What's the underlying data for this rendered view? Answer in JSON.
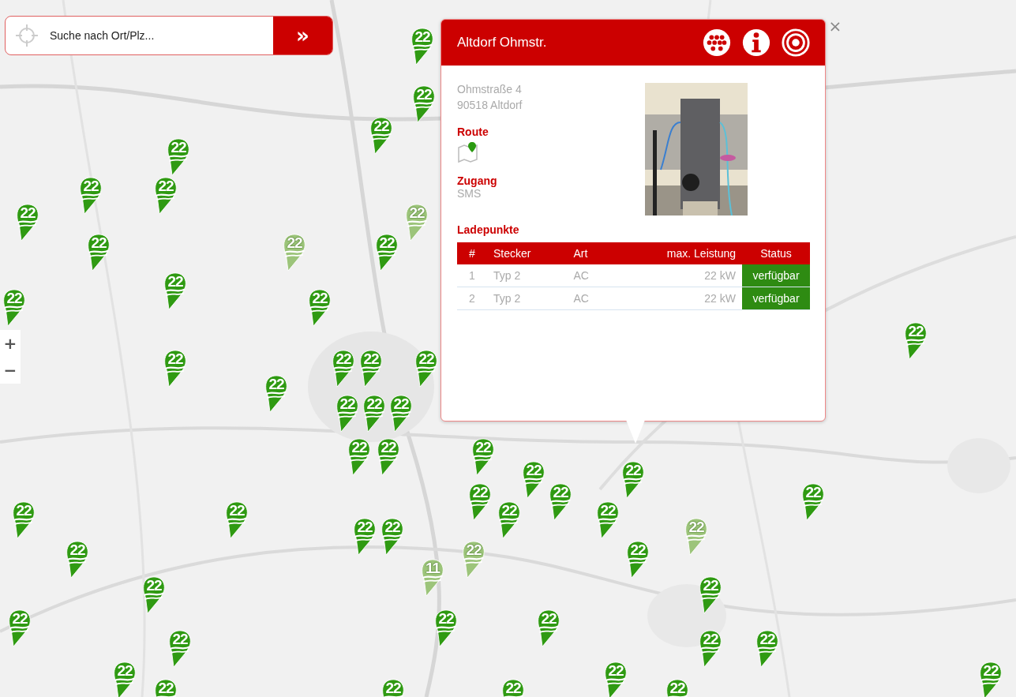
{
  "search": {
    "placeholder": "Suche nach Ort/Plz...",
    "button": "»"
  },
  "zoom_controls": [
    "+",
    "−"
  ],
  "markers": [
    {
      "label": "22",
      "faded": false
    },
    {
      "label": "22",
      "faded": false
    },
    {
      "label": "22",
      "faded": false
    },
    {
      "label": "22",
      "faded": false
    },
    {
      "label": "22",
      "faded": false
    },
    {
      "label": "22",
      "faded": false
    },
    {
      "label": "22",
      "faded": false
    },
    {
      "label": "22",
      "faded": true
    },
    {
      "label": "22",
      "faded": false
    },
    {
      "label": "22",
      "faded": true
    },
    {
      "label": "22",
      "faded": false
    },
    {
      "label": "22",
      "faded": false
    },
    {
      "label": "22",
      "faded": false
    },
    {
      "label": "22",
      "faded": false
    },
    {
      "label": "22",
      "faded": false
    },
    {
      "label": "22",
      "faded": false
    },
    {
      "label": "22",
      "faded": false
    },
    {
      "label": "22",
      "faded": false
    },
    {
      "label": "22",
      "faded": false
    },
    {
      "label": "22",
      "faded": false
    },
    {
      "label": "22",
      "faded": false
    },
    {
      "label": "22",
      "faded": false
    },
    {
      "label": "22",
      "faded": false
    },
    {
      "label": "22",
      "faded": false
    },
    {
      "label": "22",
      "faded": false
    },
    {
      "label": "22",
      "faded": false
    },
    {
      "label": "22",
      "faded": false
    },
    {
      "label": "22",
      "faded": false
    },
    {
      "label": "22",
      "faded": false
    },
    {
      "label": "22",
      "faded": false
    },
    {
      "label": "22",
      "faded": false
    },
    {
      "label": "22",
      "faded": false
    },
    {
      "label": "22",
      "faded": false
    },
    {
      "label": "22",
      "faded": false
    },
    {
      "label": "22",
      "faded": false
    },
    {
      "label": "22",
      "faded": false
    },
    {
      "label": "22",
      "faded": false
    },
    {
      "label": "22",
      "faded": true
    },
    {
      "label": "22",
      "faded": false
    },
    {
      "label": "22",
      "faded": true
    },
    {
      "label": "22",
      "faded": false
    },
    {
      "label": "11",
      "faded": true
    },
    {
      "label": "22",
      "faded": false
    },
    {
      "label": "22",
      "faded": false
    },
    {
      "label": "22",
      "faded": false
    },
    {
      "label": "22",
      "faded": false
    },
    {
      "label": "22",
      "faded": false
    },
    {
      "label": "22",
      "faded": false
    },
    {
      "label": "22",
      "faded": false
    },
    {
      "label": "22",
      "faded": false
    },
    {
      "label": "22",
      "faded": false
    },
    {
      "label": "22",
      "faded": false
    },
    {
      "label": "22",
      "faded": false
    },
    {
      "label": "22",
      "faded": false
    },
    {
      "label": "22",
      "faded": false
    },
    {
      "label": "22",
      "faded": false
    },
    {
      "label": "22",
      "faded": false
    }
  ],
  "popup": {
    "title": "Altdorf Ohmstr.",
    "close": "×",
    "address": [
      "Ohmstraße 4",
      "90518 Altdorf"
    ],
    "route_label": "Route",
    "access_label": "Zugang",
    "access": "SMS",
    "points_label": "Ladepunkte",
    "table": {
      "columns": [
        "#",
        "Stecker",
        "Art",
        "max. Leistung",
        "Status"
      ],
      "rows": [
        {
          "cells": [
            "1",
            "Typ 2",
            "AC",
            "22 kW"
          ],
          "status": "verfügbar",
          "available": true
        },
        {
          "cells": [
            "2",
            "Typ 2",
            "AC",
            "22 kW"
          ],
          "status": "verfügbar",
          "available": true
        }
      ]
    }
  }
}
